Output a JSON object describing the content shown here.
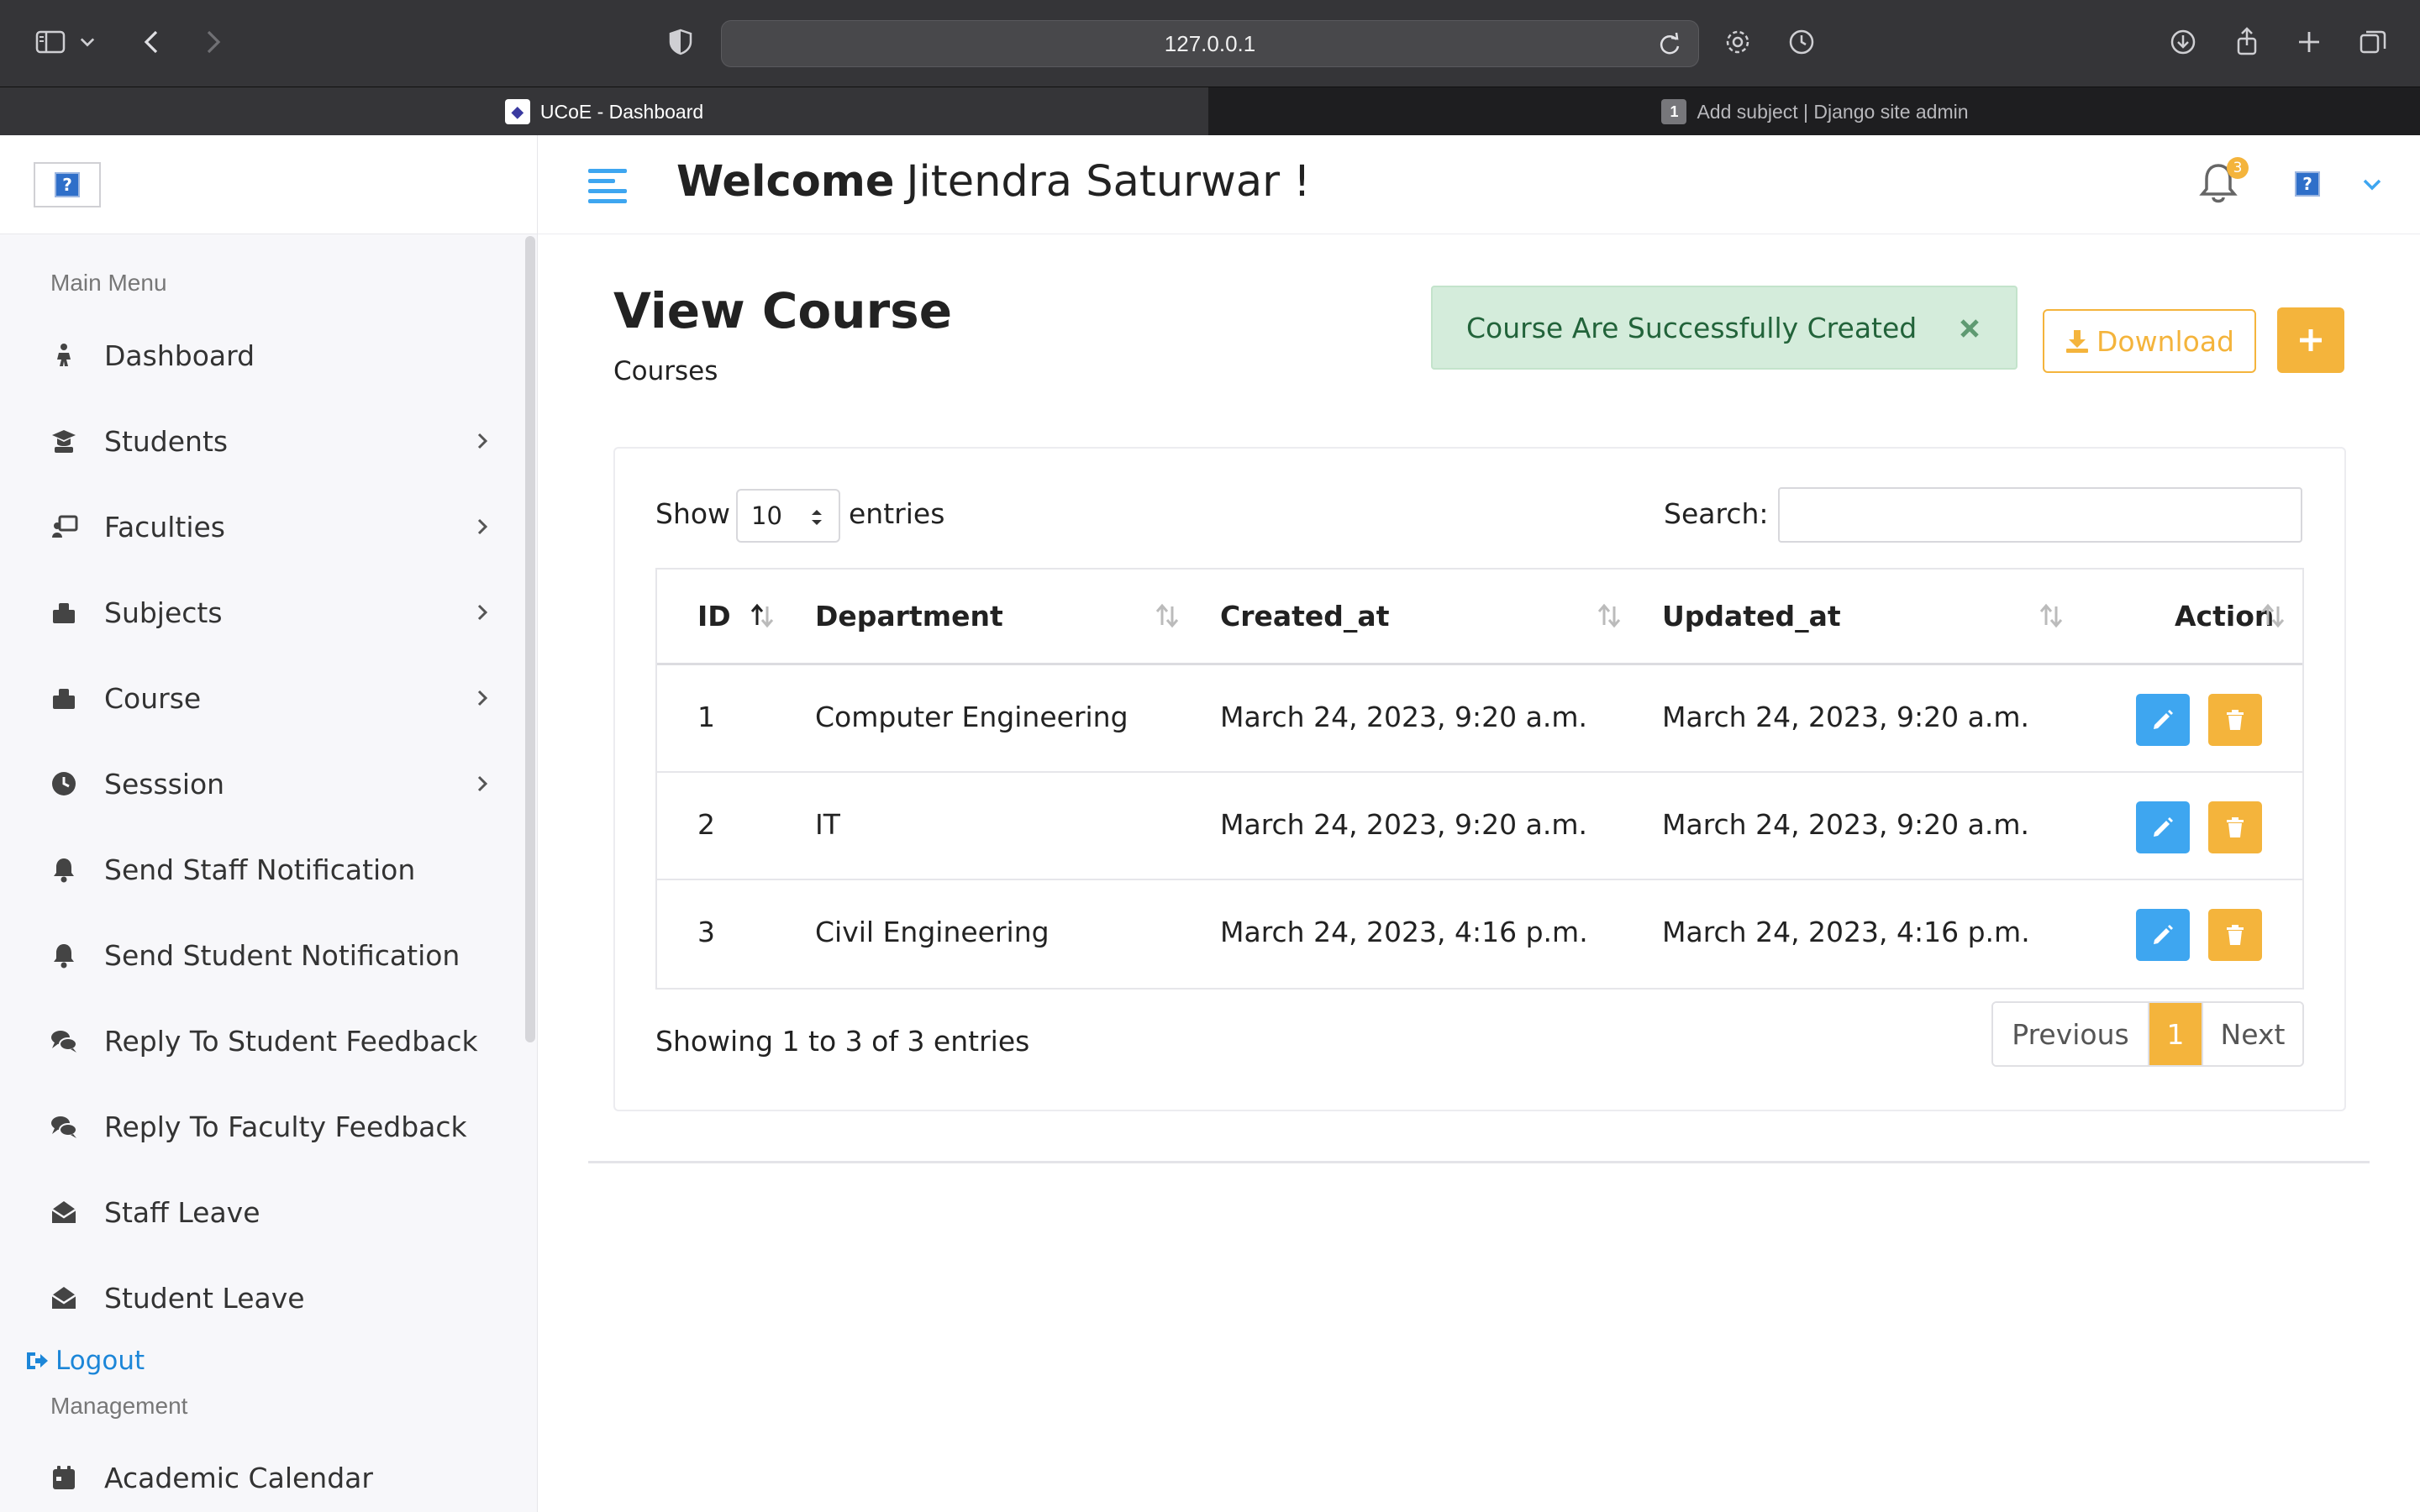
{
  "browser": {
    "url": "127.0.0.1",
    "tabs": [
      {
        "title": "UCoE - Dashboard",
        "active": true,
        "favicon": "ucoe-logo-icon"
      },
      {
        "title": "Add subject | Django site admin",
        "active": false,
        "favicon_text": "1"
      }
    ]
  },
  "sidebar": {
    "main_menu_label": "Main Menu",
    "items": [
      {
        "label": "Dashboard",
        "icon": "dashboard-icon",
        "submenu": false
      },
      {
        "label": "Students",
        "icon": "student-icon",
        "submenu": true
      },
      {
        "label": "Faculties",
        "icon": "faculty-icon",
        "submenu": true
      },
      {
        "label": "Subjects",
        "icon": "book-icon",
        "submenu": true
      },
      {
        "label": "Course",
        "icon": "book-icon",
        "submenu": true
      },
      {
        "label": "Sesssion",
        "icon": "clock-icon",
        "submenu": true
      },
      {
        "label": "Send Staff Notification",
        "icon": "bell-icon",
        "submenu": false
      },
      {
        "label": "Send Student Notification",
        "icon": "bell-icon",
        "submenu": false
      },
      {
        "label": "Reply To Student Feedback",
        "icon": "comments-icon",
        "submenu": false
      },
      {
        "label": "Reply To Faculty Feedback",
        "icon": "comments-icon",
        "submenu": false
      },
      {
        "label": "Staff Leave",
        "icon": "envelope-open-icon",
        "submenu": false
      },
      {
        "label": "Student Leave",
        "icon": "envelope-open-icon",
        "submenu": false
      }
    ],
    "logout_label": "Logout",
    "management_label": "Management",
    "management_items": [
      {
        "label": "Academic Calendar",
        "icon": "calendar-icon"
      }
    ]
  },
  "header": {
    "welcome_bold": "Welcome",
    "user_name": "Jitendra Saturwar  !",
    "notification_count": "3"
  },
  "page": {
    "title": "View Course",
    "breadcrumb": "Courses",
    "alert_message": "Course Are Successfully Created",
    "download_label": "Download"
  },
  "table_controls": {
    "show_label": "Show",
    "entries_value": "10",
    "entries_label": "entries",
    "search_label": "Search:",
    "search_value": ""
  },
  "table": {
    "columns": [
      "ID",
      "Department",
      "Created_at",
      "Updated_at",
      "Action"
    ],
    "rows": [
      {
        "id": "1",
        "department": "Computer Engineering",
        "created_at": "March 24, 2023, 9:20 a.m.",
        "updated_at": "March 24, 2023, 9:20 a.m."
      },
      {
        "id": "2",
        "department": "IT",
        "created_at": "March 24, 2023, 9:20 a.m.",
        "updated_at": "March 24, 2023, 9:20 a.m."
      },
      {
        "id": "3",
        "department": "Civil Engineering",
        "created_at": "March 24, 2023, 4:16 p.m.",
        "updated_at": "March 24, 2023, 4:16 p.m."
      }
    ]
  },
  "pagination": {
    "info": "Showing 1 to 3 of 3 entries",
    "previous_label": "Previous",
    "current_page": "1",
    "next_label": "Next"
  },
  "colors": {
    "accent_warning": "#f4b43c",
    "accent_info": "#3ea6f0",
    "alert_bg": "#d4ecdb",
    "alert_text": "#22633a",
    "link": "#1c86d8"
  }
}
